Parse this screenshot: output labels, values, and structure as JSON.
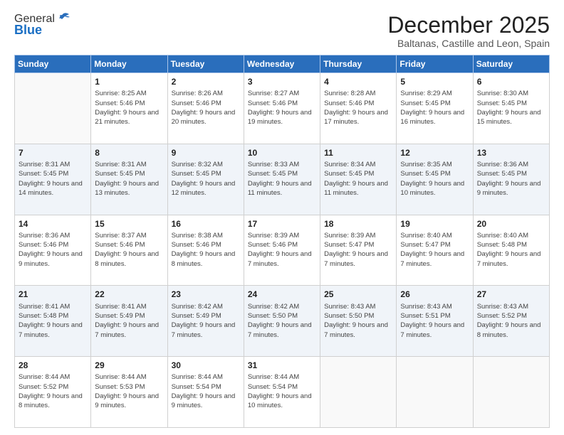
{
  "logo": {
    "general": "General",
    "blue": "Blue"
  },
  "header": {
    "month": "December 2025",
    "location": "Baltanas, Castille and Leon, Spain"
  },
  "days": [
    "Sunday",
    "Monday",
    "Tuesday",
    "Wednesday",
    "Thursday",
    "Friday",
    "Saturday"
  ],
  "weeks": [
    [
      {
        "num": "",
        "sunrise": "",
        "sunset": "",
        "daylight": ""
      },
      {
        "num": "1",
        "sunrise": "Sunrise: 8:25 AM",
        "sunset": "Sunset: 5:46 PM",
        "daylight": "Daylight: 9 hours and 21 minutes."
      },
      {
        "num": "2",
        "sunrise": "Sunrise: 8:26 AM",
        "sunset": "Sunset: 5:46 PM",
        "daylight": "Daylight: 9 hours and 20 minutes."
      },
      {
        "num": "3",
        "sunrise": "Sunrise: 8:27 AM",
        "sunset": "Sunset: 5:46 PM",
        "daylight": "Daylight: 9 hours and 19 minutes."
      },
      {
        "num": "4",
        "sunrise": "Sunrise: 8:28 AM",
        "sunset": "Sunset: 5:46 PM",
        "daylight": "Daylight: 9 hours and 17 minutes."
      },
      {
        "num": "5",
        "sunrise": "Sunrise: 8:29 AM",
        "sunset": "Sunset: 5:45 PM",
        "daylight": "Daylight: 9 hours and 16 minutes."
      },
      {
        "num": "6",
        "sunrise": "Sunrise: 8:30 AM",
        "sunset": "Sunset: 5:45 PM",
        "daylight": "Daylight: 9 hours and 15 minutes."
      }
    ],
    [
      {
        "num": "7",
        "sunrise": "Sunrise: 8:31 AM",
        "sunset": "Sunset: 5:45 PM",
        "daylight": "Daylight: 9 hours and 14 minutes."
      },
      {
        "num": "8",
        "sunrise": "Sunrise: 8:31 AM",
        "sunset": "Sunset: 5:45 PM",
        "daylight": "Daylight: 9 hours and 13 minutes."
      },
      {
        "num": "9",
        "sunrise": "Sunrise: 8:32 AM",
        "sunset": "Sunset: 5:45 PM",
        "daylight": "Daylight: 9 hours and 12 minutes."
      },
      {
        "num": "10",
        "sunrise": "Sunrise: 8:33 AM",
        "sunset": "Sunset: 5:45 PM",
        "daylight": "Daylight: 9 hours and 11 minutes."
      },
      {
        "num": "11",
        "sunrise": "Sunrise: 8:34 AM",
        "sunset": "Sunset: 5:45 PM",
        "daylight": "Daylight: 9 hours and 11 minutes."
      },
      {
        "num": "12",
        "sunrise": "Sunrise: 8:35 AM",
        "sunset": "Sunset: 5:45 PM",
        "daylight": "Daylight: 9 hours and 10 minutes."
      },
      {
        "num": "13",
        "sunrise": "Sunrise: 8:36 AM",
        "sunset": "Sunset: 5:45 PM",
        "daylight": "Daylight: 9 hours and 9 minutes."
      }
    ],
    [
      {
        "num": "14",
        "sunrise": "Sunrise: 8:36 AM",
        "sunset": "Sunset: 5:46 PM",
        "daylight": "Daylight: 9 hours and 9 minutes."
      },
      {
        "num": "15",
        "sunrise": "Sunrise: 8:37 AM",
        "sunset": "Sunset: 5:46 PM",
        "daylight": "Daylight: 9 hours and 8 minutes."
      },
      {
        "num": "16",
        "sunrise": "Sunrise: 8:38 AM",
        "sunset": "Sunset: 5:46 PM",
        "daylight": "Daylight: 9 hours and 8 minutes."
      },
      {
        "num": "17",
        "sunrise": "Sunrise: 8:39 AM",
        "sunset": "Sunset: 5:46 PM",
        "daylight": "Daylight: 9 hours and 7 minutes."
      },
      {
        "num": "18",
        "sunrise": "Sunrise: 8:39 AM",
        "sunset": "Sunset: 5:47 PM",
        "daylight": "Daylight: 9 hours and 7 minutes."
      },
      {
        "num": "19",
        "sunrise": "Sunrise: 8:40 AM",
        "sunset": "Sunset: 5:47 PM",
        "daylight": "Daylight: 9 hours and 7 minutes."
      },
      {
        "num": "20",
        "sunrise": "Sunrise: 8:40 AM",
        "sunset": "Sunset: 5:48 PM",
        "daylight": "Daylight: 9 hours and 7 minutes."
      }
    ],
    [
      {
        "num": "21",
        "sunrise": "Sunrise: 8:41 AM",
        "sunset": "Sunset: 5:48 PM",
        "daylight": "Daylight: 9 hours and 7 minutes."
      },
      {
        "num": "22",
        "sunrise": "Sunrise: 8:41 AM",
        "sunset": "Sunset: 5:49 PM",
        "daylight": "Daylight: 9 hours and 7 minutes."
      },
      {
        "num": "23",
        "sunrise": "Sunrise: 8:42 AM",
        "sunset": "Sunset: 5:49 PM",
        "daylight": "Daylight: 9 hours and 7 minutes."
      },
      {
        "num": "24",
        "sunrise": "Sunrise: 8:42 AM",
        "sunset": "Sunset: 5:50 PM",
        "daylight": "Daylight: 9 hours and 7 minutes."
      },
      {
        "num": "25",
        "sunrise": "Sunrise: 8:43 AM",
        "sunset": "Sunset: 5:50 PM",
        "daylight": "Daylight: 9 hours and 7 minutes."
      },
      {
        "num": "26",
        "sunrise": "Sunrise: 8:43 AM",
        "sunset": "Sunset: 5:51 PM",
        "daylight": "Daylight: 9 hours and 7 minutes."
      },
      {
        "num": "27",
        "sunrise": "Sunrise: 8:43 AM",
        "sunset": "Sunset: 5:52 PM",
        "daylight": "Daylight: 9 hours and 8 minutes."
      }
    ],
    [
      {
        "num": "28",
        "sunrise": "Sunrise: 8:44 AM",
        "sunset": "Sunset: 5:52 PM",
        "daylight": "Daylight: 9 hours and 8 minutes."
      },
      {
        "num": "29",
        "sunrise": "Sunrise: 8:44 AM",
        "sunset": "Sunset: 5:53 PM",
        "daylight": "Daylight: 9 hours and 9 minutes."
      },
      {
        "num": "30",
        "sunrise": "Sunrise: 8:44 AM",
        "sunset": "Sunset: 5:54 PM",
        "daylight": "Daylight: 9 hours and 9 minutes."
      },
      {
        "num": "31",
        "sunrise": "Sunrise: 8:44 AM",
        "sunset": "Sunset: 5:54 PM",
        "daylight": "Daylight: 9 hours and 10 minutes."
      },
      {
        "num": "",
        "sunrise": "",
        "sunset": "",
        "daylight": ""
      },
      {
        "num": "",
        "sunrise": "",
        "sunset": "",
        "daylight": ""
      },
      {
        "num": "",
        "sunrise": "",
        "sunset": "",
        "daylight": ""
      }
    ]
  ]
}
